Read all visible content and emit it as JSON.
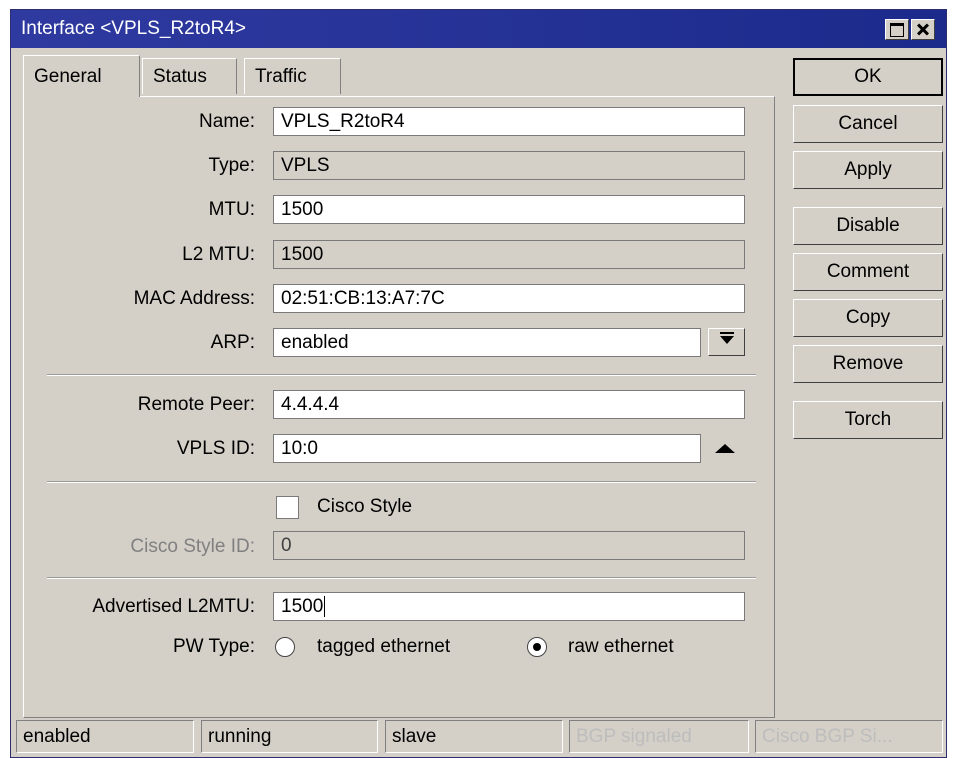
{
  "window": {
    "title": "Interface <VPLS_R2toR4>"
  },
  "tabs": [
    {
      "label": "General"
    },
    {
      "label": "Status"
    },
    {
      "label": "Traffic"
    }
  ],
  "form": {
    "name": {
      "label": "Name:",
      "value": "VPLS_R2toR4"
    },
    "type": {
      "label": "Type:",
      "value": "VPLS"
    },
    "mtu": {
      "label": "MTU:",
      "value": "1500"
    },
    "l2mtu": {
      "label": "L2 MTU:",
      "value": "1500"
    },
    "mac": {
      "label": "MAC Address:",
      "value": "02:51:CB:13:A7:7C"
    },
    "arp": {
      "label": "ARP:",
      "value": "enabled"
    },
    "remote_peer": {
      "label": "Remote Peer:",
      "value": "4.4.4.4"
    },
    "vpls_id": {
      "label": "VPLS ID:",
      "value": "10:0"
    },
    "cisco_style": {
      "label": "Cisco Style",
      "checked": false
    },
    "cisco_style_id": {
      "label": "Cisco Style ID:",
      "value": "0"
    },
    "advertised_l2mtu": {
      "label": "Advertised L2MTU:",
      "value": "1500"
    },
    "pw_type": {
      "label": "PW Type:",
      "options": [
        "tagged ethernet",
        "raw ethernet"
      ],
      "selected": "raw ethernet"
    }
  },
  "buttons": {
    "ok": "OK",
    "cancel": "Cancel",
    "apply": "Apply",
    "disable": "Disable",
    "comment": "Comment",
    "copy": "Copy",
    "remove": "Remove",
    "torch": "Torch"
  },
  "statusbar": [
    "enabled",
    "running",
    "slave",
    "BGP signaled",
    "Cisco BGP Si..."
  ],
  "icons": {
    "maximize": "maximize-icon",
    "close": "close-icon",
    "dropdown": "dropdown-arrow-icon",
    "collapse": "collapse-up-arrow-icon"
  },
  "colors": {
    "titlebar": "#2f3aa0",
    "window_bg": "#d4d0c8",
    "disabled_text": "#808080"
  }
}
